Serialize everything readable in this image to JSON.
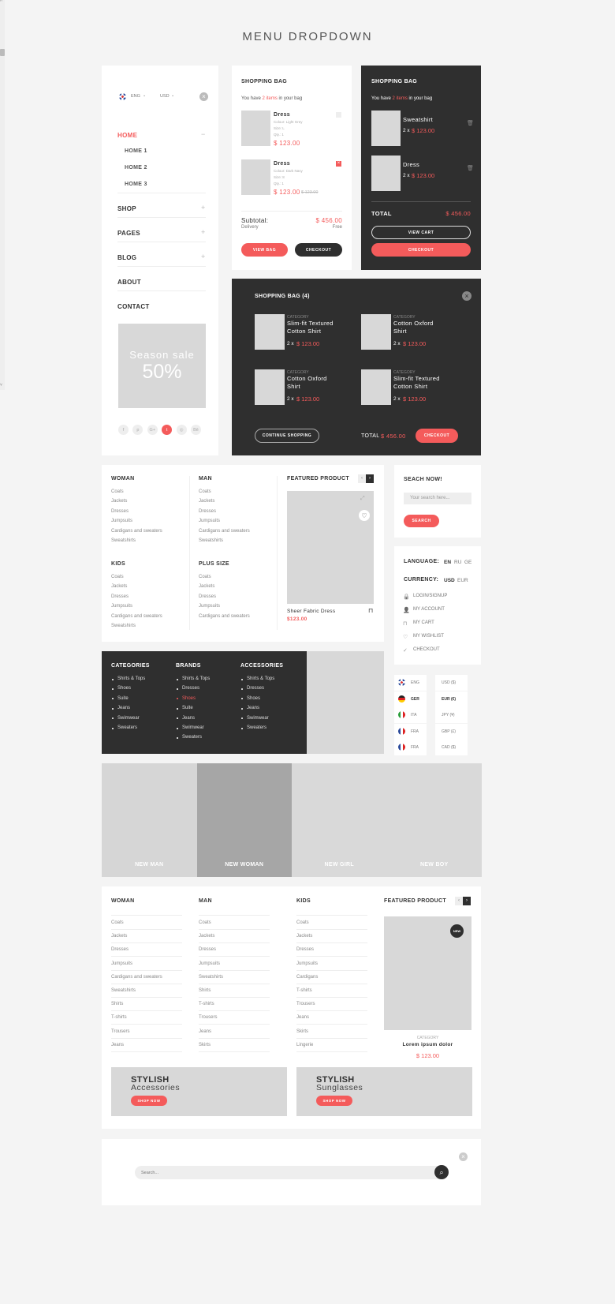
{
  "title": "MENU DROPDOWN",
  "colors": {
    "accent": "#f45b5b",
    "dark": "#2f2f2f",
    "placeholder": "#d8d8d8"
  },
  "sidebar": {
    "language": "ENG",
    "currency": "USD",
    "menu": [
      {
        "label": "HOME",
        "active": true,
        "toggle": "−",
        "children": [
          "HOME 1",
          "HOME 2",
          "HOME 3"
        ]
      },
      {
        "label": "SHOP",
        "toggle": "+"
      },
      {
        "label": "PAGES",
        "toggle": "+"
      },
      {
        "label": "BLOG",
        "toggle": "+"
      },
      {
        "label": "ABOUT"
      },
      {
        "label": "CONTACT"
      }
    ],
    "promo": {
      "line1": "Season sale",
      "line2": "50%"
    },
    "social": [
      {
        "icon": "facebook-icon",
        "glyph": "f"
      },
      {
        "icon": "pinterest-icon",
        "glyph": "p"
      },
      {
        "icon": "google-plus-icon",
        "glyph": "G+"
      },
      {
        "icon": "twitter-icon",
        "glyph": "t",
        "active": true
      },
      {
        "icon": "dribbble-icon",
        "glyph": "◎"
      },
      {
        "icon": "behance-icon",
        "glyph": "Bē"
      }
    ]
  },
  "bag_light": {
    "title": "SHOPPING BAG",
    "intro_pre": "You have ",
    "intro_count": "2 items",
    "intro_post": " in your bag",
    "items": [
      {
        "name": "Dress",
        "details": [
          "Colour: Light Grey",
          "Size: L",
          "Qty.: 1"
        ],
        "price": "$ 123.00",
        "checked": false
      },
      {
        "name": "Dress",
        "details": [
          "Colour: Dark Navy",
          "Size: 8",
          "Qty.: 1"
        ],
        "price": "$ 123.00",
        "old_price": "$ 123.00",
        "checked": true
      }
    ],
    "subtotal_label": "Subtotal:",
    "subtotal": "$ 456.00",
    "delivery_label": "Delivery",
    "delivery": "Free",
    "view_bag": "VIEW BAG",
    "checkout": "CHECKOUT"
  },
  "bag_dark": {
    "title": "SHOPPING BAG",
    "intro_pre": "You have ",
    "intro_count": "2 items",
    "intro_post": " in your bag",
    "items": [
      {
        "name": "Sweatshirt",
        "qty": "2 x",
        "price": "$ 123.00"
      },
      {
        "name": "Dress",
        "qty": "2 x",
        "price": "$ 123.00"
      }
    ],
    "total_label": "TOTAL",
    "total": "$ 456.00",
    "view_cart": "VIEW CART",
    "checkout": "CHECKOUT"
  },
  "bag_wide": {
    "title": "SHOPPING BAG (4)",
    "items": [
      {
        "category": "CATEGORY",
        "name": [
          "Slim-fit Textured",
          "Cotton Shirt"
        ],
        "qty": "2 x",
        "price": "$ 123.00"
      },
      {
        "category": "CATEGORY",
        "name": [
          "Cotton Oxford",
          "Shirt"
        ],
        "qty": "2 x",
        "price": "$ 123.00"
      },
      {
        "category": "CATEGORY",
        "name": [
          "Cotton Oxford",
          "Shirt"
        ],
        "qty": "2 x",
        "price": "$ 123.00"
      },
      {
        "category": "CATEGORY",
        "name": [
          "Slim-fit Textured",
          "Cotton Shirt"
        ],
        "qty": "2 x",
        "price": "$ 123.00"
      }
    ],
    "continue": "CONTINUE SHOPPING",
    "total_label": "TOTAL",
    "total": "$ 456.00",
    "checkout": "CHECKOUT"
  },
  "mega1": {
    "columns": [
      {
        "title": "WOMAN",
        "items": [
          "Coats",
          "Jackets",
          "Dresses",
          "Jumpsuits",
          "Cardigans and sweaters",
          "Sweatshirts"
        ]
      },
      {
        "title": "MAN",
        "items": [
          "Coats",
          "Jackets",
          "Dresses",
          "Jumpsuits",
          "Cardigans and sweaters",
          "Sweatshirts"
        ]
      },
      {
        "title": "KIDS",
        "items": [
          "Coats",
          "Jackets",
          "Dresses",
          "Jumpsuits",
          "Cardigans and sweaters",
          "Sweatshirts"
        ]
      },
      {
        "title": "PLUS SIZE",
        "items": [
          "Coats",
          "Jackets",
          "Dresses",
          "Jumpsuits",
          "Cardigans and sweaters"
        ]
      }
    ],
    "featured_title": "FEATURED PRODUCT",
    "product_name": "Sheer Fabric Dress",
    "product_price": "$123.00"
  },
  "search_box": {
    "title": "SEACH NOW!",
    "placeholder": "Your search here...",
    "button": "SEARCH"
  },
  "account": {
    "language_label": "LANGUAGE:",
    "languages": [
      "EN",
      "RU",
      "GE"
    ],
    "currency_label": "CURRENCY:",
    "currencies": [
      "USD",
      "EUR"
    ],
    "links": [
      {
        "icon": "lock-icon",
        "label": "LOGIN/SIGNUP"
      },
      {
        "icon": "user-icon",
        "label": "MY ACCOUNT"
      },
      {
        "icon": "bag-icon",
        "label": "MY CART"
      },
      {
        "icon": "heart-icon",
        "label": "MY WISHLIST"
      },
      {
        "icon": "check-circle-icon",
        "label": "CHECKOUT"
      }
    ]
  },
  "dark_menu": {
    "columns": [
      {
        "title": "CATEGORIES",
        "items": [
          "Shirts & Tops",
          "Shoes",
          "Suite",
          "Jeans",
          "Swimwear",
          "Sweaters"
        ]
      },
      {
        "title": "BRANDS",
        "items": [
          "Shirts & Tops",
          "Dresses",
          "Shoes",
          "Suite",
          "Jeans",
          "Swimwear",
          "Sweaters"
        ],
        "active": "Shoes"
      },
      {
        "title": "ACCESSORIES",
        "items": [
          "Shirts & Tops",
          "Dresses",
          "Shoes",
          "Jeans",
          "Swimwear",
          "Sweaters"
        ]
      }
    ]
  },
  "lang_list": [
    {
      "code": "ENG",
      "flag": "uk"
    },
    {
      "code": "GER",
      "flag": "de",
      "active": true
    },
    {
      "code": "ITA",
      "flag": "it"
    },
    {
      "code": "FRA",
      "flag": "fr"
    },
    {
      "code": "FRA",
      "flag": "fr"
    }
  ],
  "currency_list": [
    {
      "label": "USD ($)"
    },
    {
      "label": "EUR (€)",
      "active": true
    },
    {
      "label": "JPY (¥)"
    },
    {
      "label": "GBP (£)"
    },
    {
      "label": "CAD ($)"
    }
  ],
  "banners": [
    "NEW MAN",
    "NEW WOMAN",
    "NEW GIRL",
    "NEW BOY"
  ],
  "mega2": {
    "columns": [
      {
        "title": "WOMAN",
        "items": [
          "Coats",
          "Jackets",
          "Dresses",
          "Jumpsuits",
          "Cardigans and sweaters",
          "Sweatshirts",
          "Shirts",
          "T-shirts",
          "Trousers",
          "Jeans"
        ]
      },
      {
        "title": "MAN",
        "items": [
          "Coats",
          "Jackets",
          "Dresses",
          "Jumpsuits",
          "Sweatshirts",
          "Shirts",
          "T-shirts",
          "Trousers",
          "Jeans",
          "Skirts"
        ]
      },
      {
        "title": "KIDS",
        "items": [
          "Coats",
          "Jackets",
          "Dresses",
          "Jumpsuits",
          "Cardigans",
          "T-shirts",
          "Trousers",
          "Jeans",
          "Skirts",
          "Lingerie"
        ]
      }
    ],
    "featured_title": "FEATURED PRODUCT",
    "badge": "NEW",
    "category": "CATEGORY",
    "product_name": "Lorem ipsum dolor",
    "product_price": "$ 123.00",
    "promos": [
      {
        "title": "STYLISH",
        "subtitle": "Accessories",
        "button": "SHOP NOW"
      },
      {
        "title": "STYLISH",
        "subtitle": "Sunglasses",
        "button": "SHOP NOW"
      }
    ]
  },
  "search_bar": {
    "placeholder": "Search..."
  }
}
